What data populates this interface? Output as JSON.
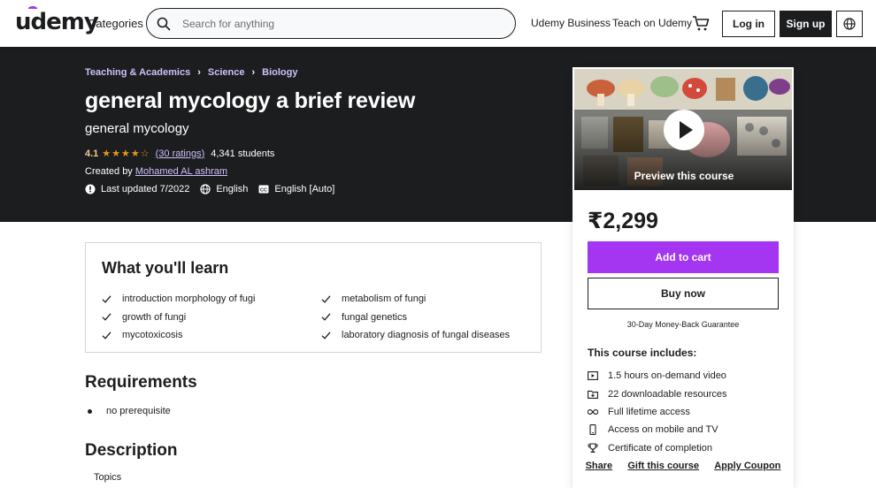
{
  "header": {
    "logo": "udemy",
    "categories": "Categories",
    "search_placeholder": "Search for anything",
    "business": "Udemy Business",
    "teach": "Teach on Udemy",
    "login": "Log in",
    "signup": "Sign up"
  },
  "course": {
    "breadcrumbs": [
      "Teaching & Academics",
      "Science",
      "Biology"
    ],
    "title": "general mycology a brief review",
    "subtitle": "general mycology",
    "rating": "4.1",
    "stars": "★★★★☆",
    "ratings_count": "(30 ratings)",
    "students": "4,341 students",
    "created_by_label": "Created by",
    "author": "Mohamed AL ashram",
    "last_updated": "Last updated 7/2022",
    "language": "English",
    "captions": "English [Auto]"
  },
  "sidebar": {
    "preview_label": "Preview this course",
    "price": "₹2,299",
    "add_to_cart": "Add to cart",
    "buy_now": "Buy now",
    "guarantee": "30-Day Money-Back Guarantee",
    "includes_heading": "This course includes:",
    "includes": [
      {
        "icon": "video-icon",
        "text": "1.5 hours on-demand video"
      },
      {
        "icon": "download-icon",
        "text": "22 downloadable resources"
      },
      {
        "icon": "infinity-icon",
        "text": "Full lifetime access"
      },
      {
        "icon": "mobile-icon",
        "text": "Access on mobile and TV"
      },
      {
        "icon": "trophy-icon",
        "text": "Certificate of completion"
      }
    ],
    "share": "Share",
    "gift": "Gift this course",
    "coupon": "Apply Coupon"
  },
  "learn": {
    "heading": "What you'll learn",
    "items": [
      "introduction morphology of fugi",
      "growth of fungi",
      "mycotoxicosis",
      "metabolism of fungi",
      "fungal genetics",
      "laboratory diagnosis of fungal diseases"
    ]
  },
  "requirements": {
    "heading": "Requirements",
    "items": [
      "no prerequisite"
    ]
  },
  "description": {
    "heading": "Description",
    "first_line": "Topics"
  },
  "colors": {
    "accent": "#a435f0",
    "dark": "#1c1d1f",
    "link_on_dark": "#cec0fc",
    "rating": "#f3ca8c",
    "star": "#e59819"
  }
}
